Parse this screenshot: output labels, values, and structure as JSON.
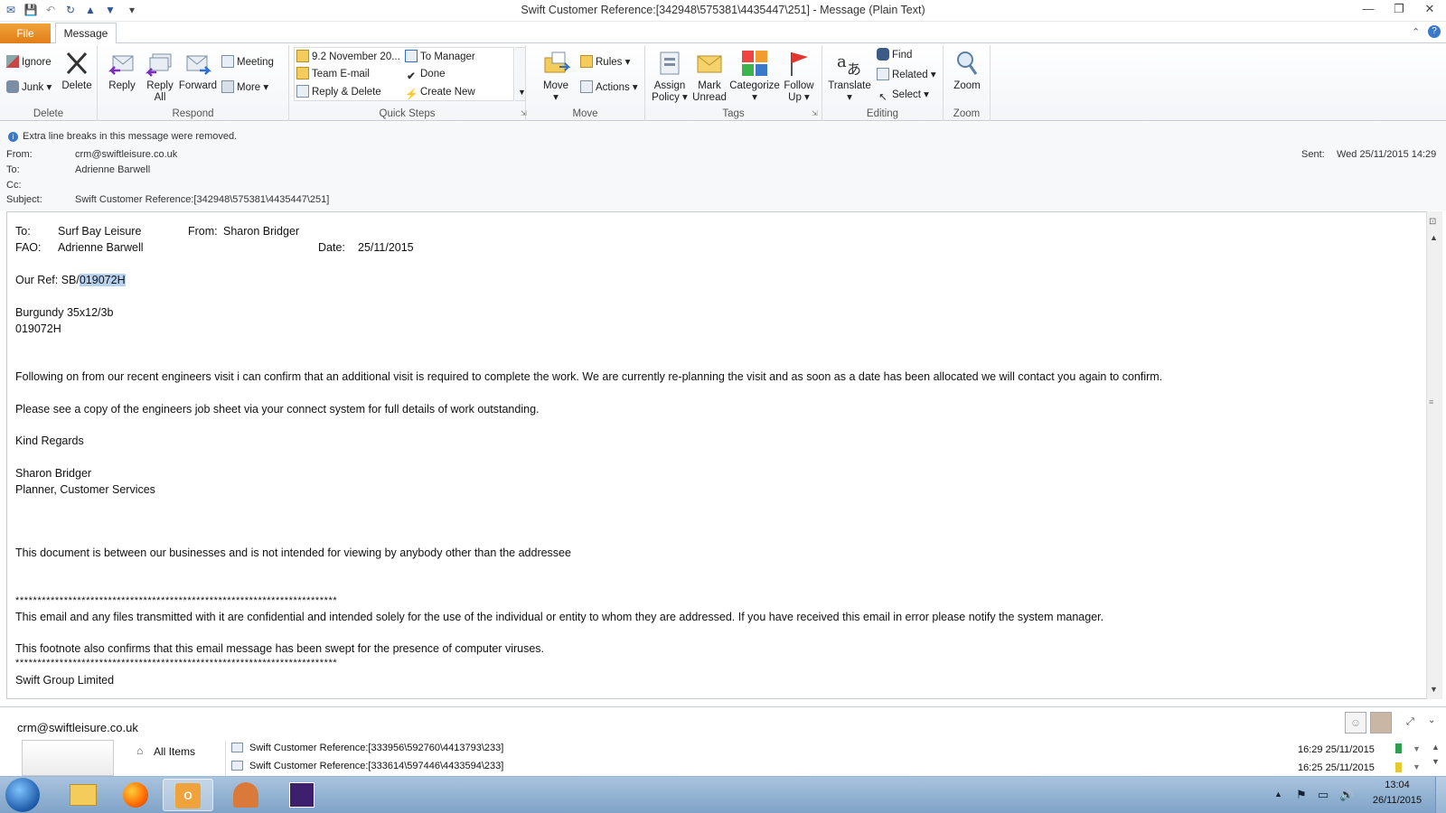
{
  "window": {
    "title": "Swift Customer Reference:[342948\\575381\\4435447\\251]  -  Message (Plain Text)",
    "controls": {
      "minimize": "—",
      "restore": "❐",
      "close": "✕"
    }
  },
  "tabs": {
    "file": "File",
    "message": "Message"
  },
  "ribbon": {
    "delete_group": {
      "label": "Delete",
      "ignore": "Ignore",
      "junk": "Junk",
      "delete": "Delete"
    },
    "respond_group": {
      "label": "Respond",
      "reply": "Reply",
      "reply_all_1": "Reply",
      "reply_all_2": "All",
      "forward": "Forward",
      "meeting": "Meeting",
      "more": "More"
    },
    "quick_steps_group": {
      "label": "Quick Steps",
      "items": [
        "9.2 November 20...",
        "Team E-mail",
        "Reply & Delete",
        "To Manager",
        "Done",
        "Create New"
      ]
    },
    "move_group": {
      "label": "Move",
      "move": "Move",
      "rules": "Rules",
      "actions": "Actions"
    },
    "tags_group": {
      "label": "Tags",
      "assign_1": "Assign",
      "assign_2": "Policy",
      "mark_1": "Mark",
      "mark_2": "Unread",
      "categorize": "Categorize",
      "follow_1": "Follow",
      "follow_2": "Up"
    },
    "editing_group": {
      "label": "Editing",
      "translate": "Translate",
      "find": "Find",
      "related": "Related",
      "select": "Select"
    },
    "zoom_group": {
      "label": "Zoom",
      "zoom": "Zoom"
    }
  },
  "header": {
    "info": "Extra line breaks in this message were removed.",
    "from_label": "From:",
    "from": "crm@swiftleisure.co.uk",
    "to_label": "To:",
    "to": "Adrienne Barwell",
    "cc_label": "Cc:",
    "subject_label": "Subject:",
    "subject": "Swift Customer Reference:[342948\\575381\\4435447\\251]",
    "sent_label": "Sent:",
    "sent": "Wed 25/11/2015 14:29"
  },
  "body": {
    "to_label": "To:",
    "to_value": "Surf Bay Leisure",
    "from_label": "From:",
    "from_value": "Sharon Bridger",
    "fao_label": "FAO:",
    "fao_value": "Adrienne Barwell",
    "date_label": "Date:",
    "date_value": "25/11/2015",
    "ref_prefix": "Our Ref: SB/",
    "ref_highlight": "019072H",
    "product": "Burgundy 35x12/3b",
    "product_code": "019072H",
    "para1": "Following on from our recent engineers visit i can confirm that an additional visit is required to complete the work. We are currently re-planning the visit and as soon as a date has been allocated we will contact you again to confirm.",
    "para2": "Please see a copy of the engineers job sheet via your connect system for full details of work outstanding.",
    "regards": "Kind Regards",
    "sig_name": "Sharon Bridger",
    "sig_title": "Planner, Customer Services",
    "notice": "This document is between our businesses and is not intended for viewing by anybody other than the addressee",
    "stars": "*************************************************************************",
    "disclaimer1": "This email and any files transmitted with it are confidential and intended solely for the use of the individual or entity to whom they are addressed. If you have received this email in error please notify the system manager.",
    "disclaimer2": "This footnote also confirms that this email message has been swept for the presence of computer viruses.",
    "company": "Swift Group Limited"
  },
  "people_pane": {
    "contact": "crm@swiftleisure.co.uk",
    "all_items": "All Items",
    "rows": [
      {
        "subject": "Swift Customer Reference:[333956\\592760\\4413793\\233]",
        "time": "16:29  25/11/2015",
        "flag_color": "#2e9e4f"
      },
      {
        "subject": "Swift Customer Reference:[333614\\597446\\4433594\\233]",
        "time": "16:25  25/11/2015",
        "flag_color": "#e8c92e"
      }
    ]
  },
  "taskbar": {
    "time": "13:04",
    "date": "26/11/2015"
  },
  "colors": {
    "file_tab": "#e27d16",
    "highlight": "#b7d1ee",
    "taskbar": "#8eb0d3"
  }
}
